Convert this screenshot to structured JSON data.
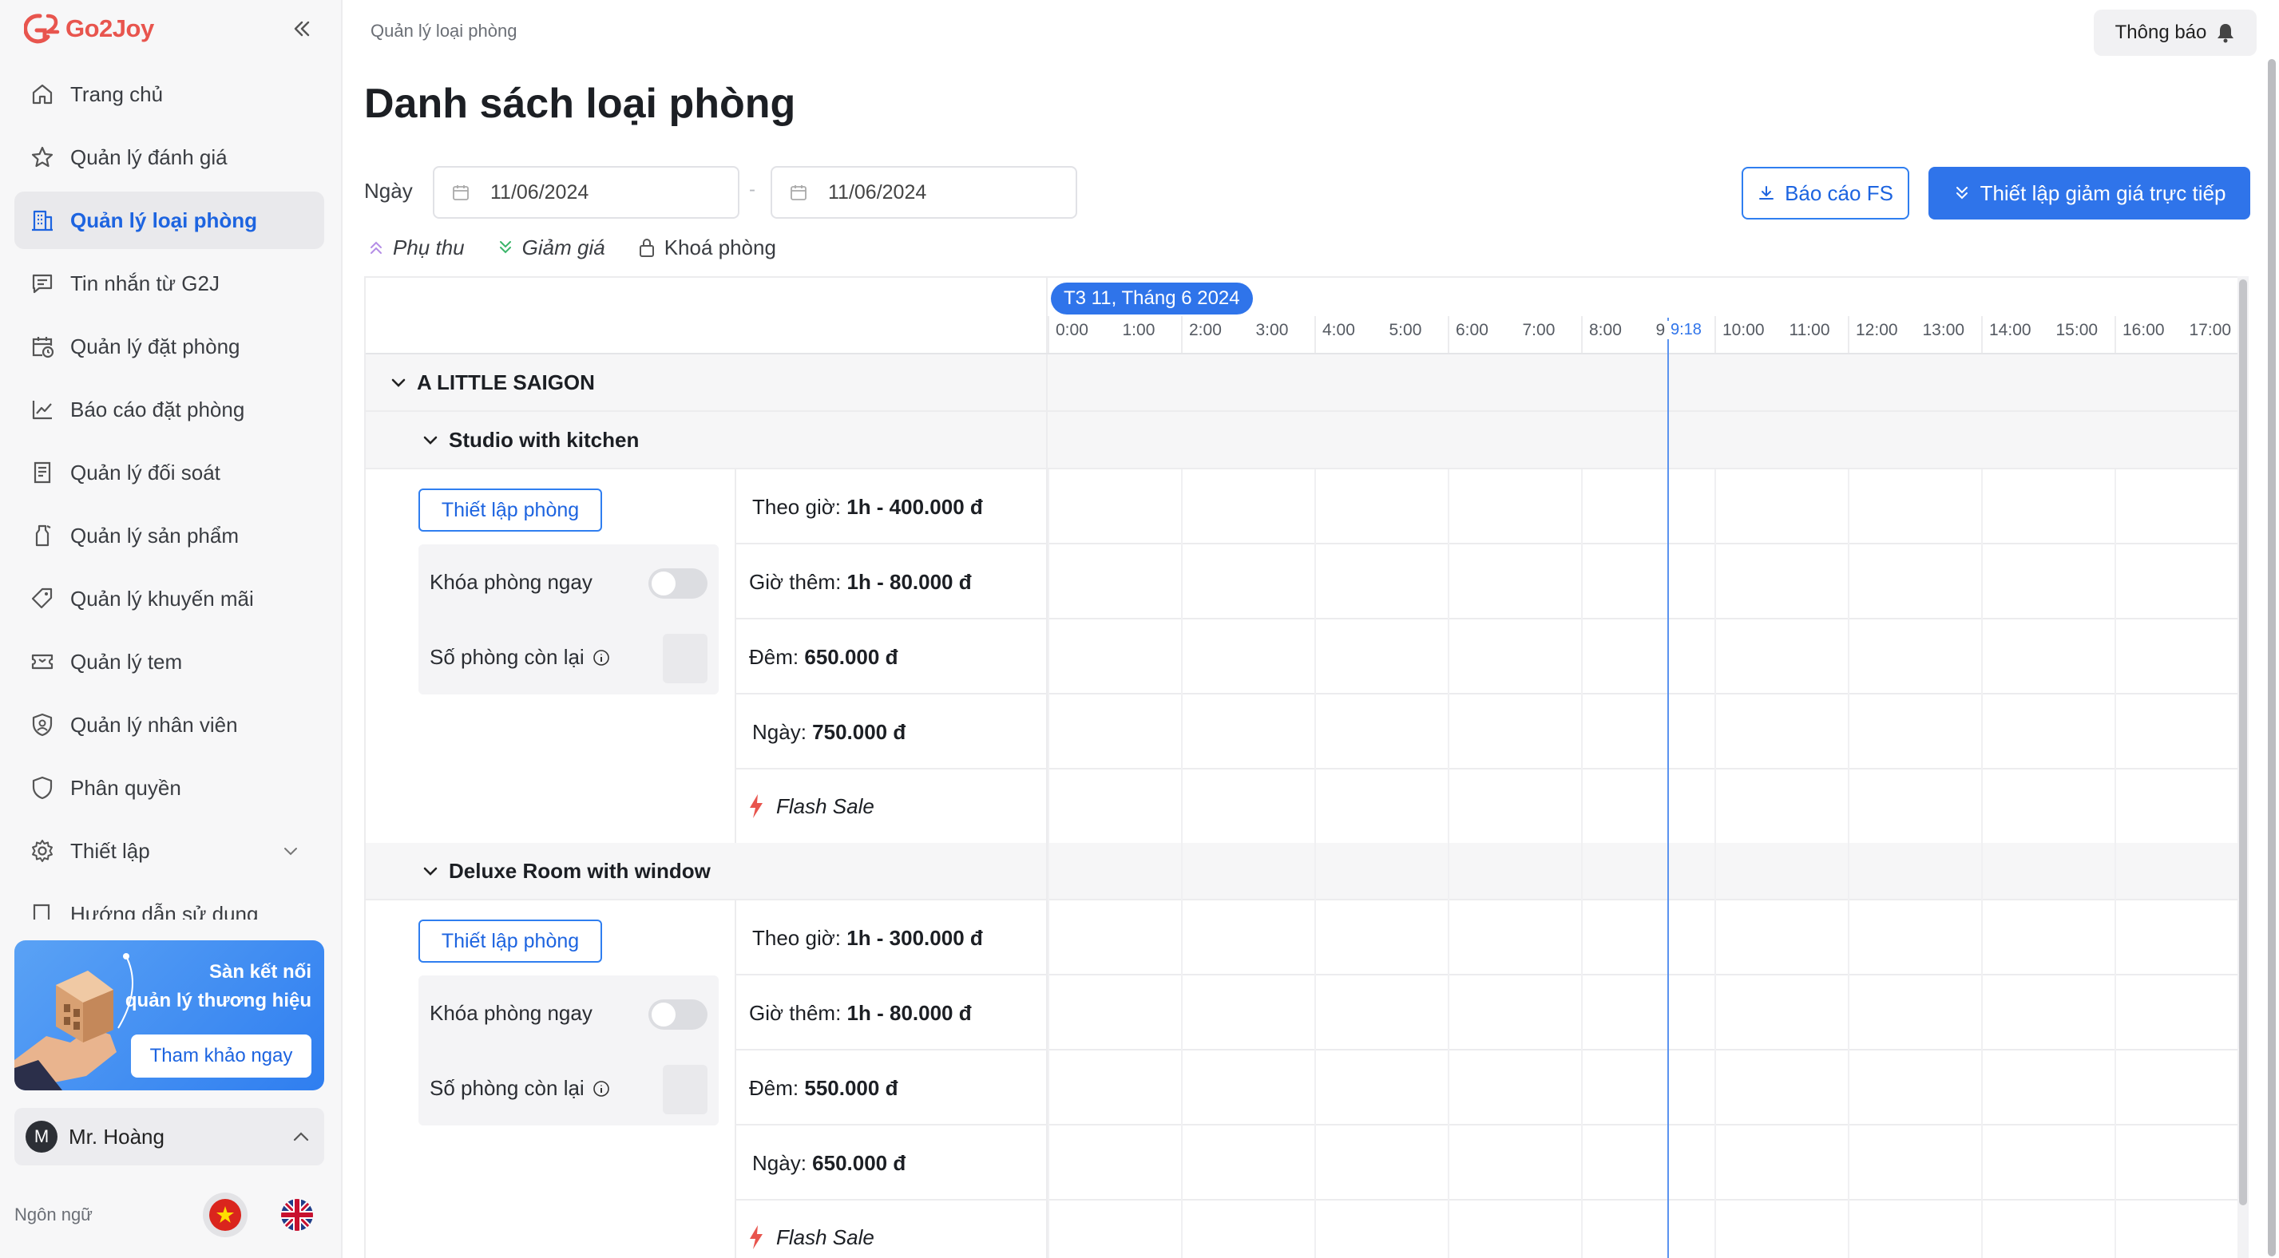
{
  "app": {
    "brand": "Go2Joy",
    "brand_color": "#e8554e",
    "accent_color": "#2f74ea"
  },
  "sidebar": {
    "items": [
      {
        "label": "Trang chủ",
        "icon": "home-icon"
      },
      {
        "label": "Quản lý đánh giá",
        "icon": "star-icon"
      },
      {
        "label": "Quản lý loại phòng",
        "icon": "building-icon",
        "active": true
      },
      {
        "label": "Tin nhắn từ G2J",
        "icon": "message-icon"
      },
      {
        "label": "Quản lý đặt phòng",
        "icon": "calendar-clock-icon"
      },
      {
        "label": "Báo cáo đặt phòng",
        "icon": "line-chart-icon"
      },
      {
        "label": "Quản lý đối soát",
        "icon": "receipt-icon"
      },
      {
        "label": "Quản lý sản phẩm",
        "icon": "bottle-icon"
      },
      {
        "label": "Quản lý khuyến mãi",
        "icon": "tag-icon"
      },
      {
        "label": "Quản lý tem",
        "icon": "ticket-icon"
      },
      {
        "label": "Quản lý nhân viên",
        "icon": "user-shield-icon"
      },
      {
        "label": "Phân quyền",
        "icon": "shield-icon"
      },
      {
        "label": "Thiết lập",
        "icon": "gear-icon"
      },
      {
        "label": "Hướng dẫn sử dụng",
        "icon": "book-icon"
      }
    ],
    "promo": {
      "line1": "Sàn kết nối",
      "line2": "quản lý thương hiệu",
      "button": "Tham khảo ngay"
    },
    "user": {
      "initial": "M",
      "name": "Mr. Hoàng"
    },
    "language_label": "Ngôn ngữ"
  },
  "header": {
    "breadcrumb": "Quản lý loại phòng",
    "notification": "Thông báo",
    "title": "Danh sách loại phòng"
  },
  "filters": {
    "label": "Ngày",
    "date_from": "11/06/2024",
    "date_to": "11/06/2024",
    "separator": "-",
    "report_button": "Báo cáo FS",
    "discount_button": "Thiết lập giảm giá trực tiếp"
  },
  "legend": {
    "surcharge": "Phụ thu",
    "discount": "Giảm giá",
    "lock": "Khoá phòng"
  },
  "timeline": {
    "date_label": "T3 11, Tháng 6 2024",
    "hours": [
      "0:00",
      "1:00",
      "2:00",
      "3:00",
      "4:00",
      "5:00",
      "6:00",
      "7:00",
      "8:00",
      "9",
      "10:00",
      "11:00",
      "12:00",
      "13:00",
      "14:00",
      "15:00",
      "16:00",
      "17:00"
    ],
    "now": "9:18"
  },
  "hotel": {
    "name": "A LITTLE SAIGON",
    "rooms": [
      {
        "name": "Studio with kitchen",
        "setup_button": "Thiết lập phòng",
        "lock_label": "Khóa phòng ngay",
        "remaining_label": "Số phòng còn lại",
        "prices": [
          {
            "label": "Theo giờ:",
            "value": "1h - 400.000 đ"
          },
          {
            "label": "Giờ thêm:",
            "value": "1h - 80.000 đ"
          },
          {
            "label": "Đêm:",
            "value": "650.000 đ"
          },
          {
            "label": "Ngày:",
            "value": "750.000 đ"
          }
        ],
        "flash_sale": "Flash Sale"
      },
      {
        "name": "Deluxe Room with window",
        "setup_button": "Thiết lập phòng",
        "lock_label": "Khóa phòng ngay",
        "remaining_label": "Số phòng còn lại",
        "prices": [
          {
            "label": "Theo giờ:",
            "value": "1h - 300.000 đ"
          },
          {
            "label": "Giờ thêm:",
            "value": "1h - 80.000 đ"
          },
          {
            "label": "Đêm:",
            "value": "550.000 đ"
          },
          {
            "label": "Ngày:",
            "value": "650.000 đ"
          }
        ],
        "flash_sale": "Flash Sale"
      }
    ]
  }
}
